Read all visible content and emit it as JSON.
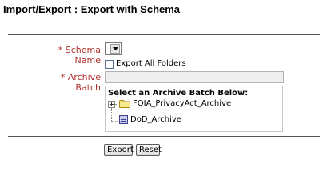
{
  "page": {
    "title": "Import/Export : Export with Schema"
  },
  "form": {
    "schema_name_label": "Schema Name",
    "schema_select_value": "",
    "export_all_folders_label": "Export All Folders",
    "export_all_folders_checked": false,
    "archive_batch_label": "Archive Batch",
    "archive_batch_value": "",
    "required_marker": "*",
    "required_color": "#b0302e"
  },
  "tree": {
    "heading": "Select an Archive Batch Below:",
    "nodes": [
      {
        "label": "FOIA_PrivacyAct_Archive",
        "icon": "folder-icon",
        "expandable": true
      },
      {
        "label": "DoD_Archive",
        "icon": "archive-icon",
        "expandable": false
      }
    ]
  },
  "actions": {
    "export_label": "Export",
    "reset_label": "Reset"
  }
}
